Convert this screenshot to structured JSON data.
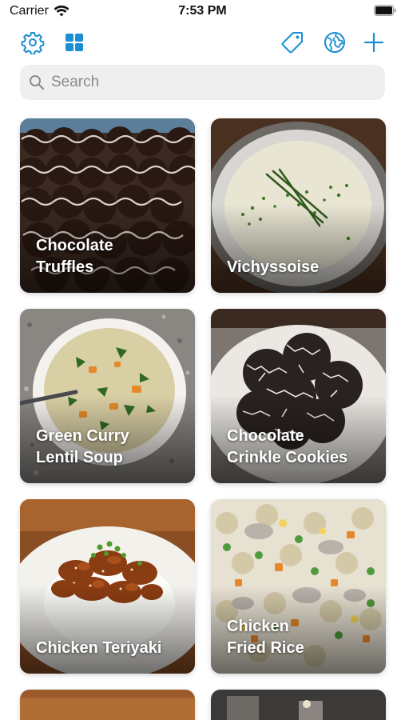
{
  "status_bar": {
    "carrier": "Carrier",
    "time": "7:53 PM"
  },
  "toolbar": {
    "left": [
      "gear-icon",
      "grid-icon"
    ],
    "right": [
      "tag-icon",
      "globe-icon",
      "plus-icon"
    ],
    "accent": "#1a8fd1"
  },
  "search": {
    "placeholder": "Search",
    "value": ""
  },
  "recipes": [
    {
      "title": "Chocolate\nTruffles"
    },
    {
      "title": "Vichyssoise"
    },
    {
      "title": "Green Curry\nLentil Soup"
    },
    {
      "title": "Chocolate\nCrinkle Cookies"
    },
    {
      "title": "Chicken Teriyaki"
    },
    {
      "title": "Chicken\nFried Rice"
    }
  ]
}
